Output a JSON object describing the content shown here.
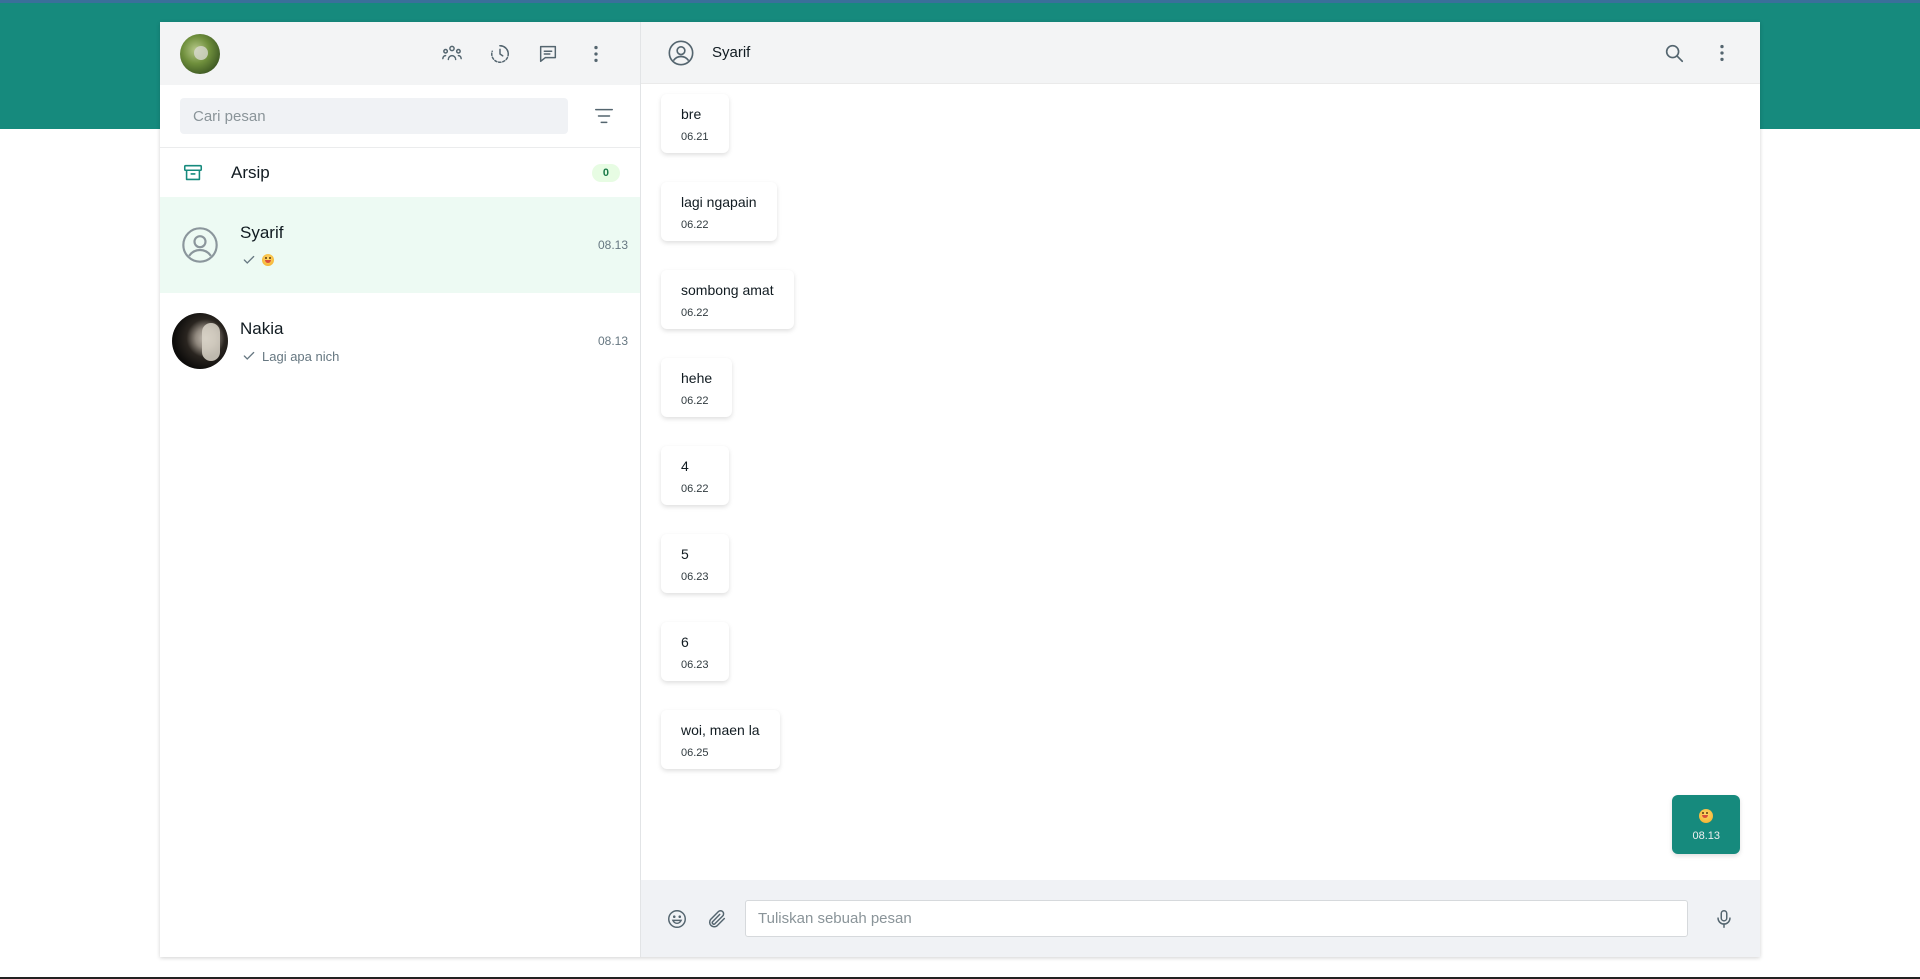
{
  "colors": {
    "brand": "#168a7d",
    "active_chat_bg": "#edfaf3",
    "badge_bg": "#e7fce3"
  },
  "sidebar": {
    "header_icons": [
      "communities-icon",
      "status-icon",
      "new-chat-icon",
      "menu-icon"
    ],
    "search": {
      "placeholder": "Cari pesan"
    },
    "archive": {
      "label": "Arsip",
      "count": "0"
    },
    "chats": [
      {
        "name": "Syarif",
        "preview": "",
        "preview_emoji": "grinning-face",
        "time": "08.13",
        "active": true
      },
      {
        "name": "Nakia",
        "preview": "Lagi apa nich",
        "time": "08.13",
        "active": false
      }
    ]
  },
  "conversation": {
    "contact_name": "Syarif",
    "messages": [
      {
        "text": "bre",
        "time": "06.21",
        "direction": "in"
      },
      {
        "text": "lagi ngapain",
        "time": "06.22",
        "direction": "in"
      },
      {
        "text": "sombong amat",
        "time": "06.22",
        "direction": "in"
      },
      {
        "text": "hehe",
        "time": "06.22",
        "direction": "in"
      },
      {
        "text": "4",
        "time": "06.22",
        "direction": "in"
      },
      {
        "text": "5",
        "time": "06.23",
        "direction": "in"
      },
      {
        "text": "6",
        "time": "06.23",
        "direction": "in"
      },
      {
        "text": "woi, maen la",
        "time": "06.25",
        "direction": "in"
      },
      {
        "emoji": "grinning-face",
        "time": "08.13",
        "direction": "out"
      }
    ],
    "composer": {
      "placeholder": "Tuliskan sebuah pesan"
    }
  }
}
